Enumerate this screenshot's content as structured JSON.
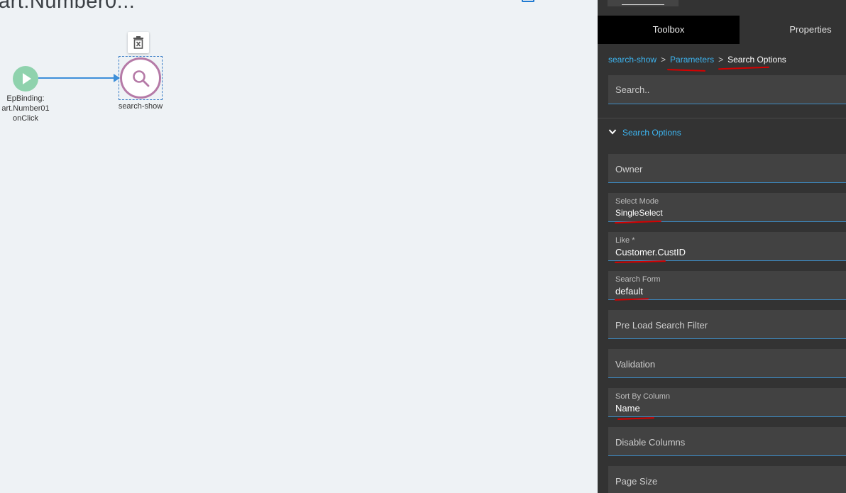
{
  "canvas": {
    "title": "art.Number0...",
    "start_node": {
      "label_lines": [
        "EpBinding:",
        "art.Number01",
        "onClick"
      ],
      "color": "#8fd2ad"
    },
    "action_node": {
      "label": "search-show",
      "color": "#b57aa7"
    },
    "connector_color": "#3d8fd9"
  },
  "panel": {
    "tabs": [
      {
        "label": "Toolbox",
        "active": false
      },
      {
        "label": "Properties",
        "active": true
      }
    ],
    "breadcrumb": [
      "search-show",
      "Parameters",
      "Search Options"
    ],
    "breadcrumb_separator": ">",
    "search": {
      "placeholder": "Search.."
    },
    "section": {
      "title": "Search Options",
      "expanded": true
    },
    "fields": [
      {
        "label": "Owner",
        "value": ""
      },
      {
        "label": "Select Mode",
        "value": "SingleSelect"
      },
      {
        "label": "Like *",
        "value": "Customer.CustID"
      },
      {
        "label": "Search Form",
        "value": "default"
      },
      {
        "label": "Pre Load Search Filter",
        "value": ""
      },
      {
        "label": "Validation",
        "value": ""
      },
      {
        "label": "Sort By Column",
        "value": "Name"
      },
      {
        "label": "Disable Columns",
        "value": ""
      },
      {
        "label": "Page Size",
        "value": ""
      }
    ],
    "accent_color": "#3db6f2",
    "annotation_color": "#d60000"
  }
}
